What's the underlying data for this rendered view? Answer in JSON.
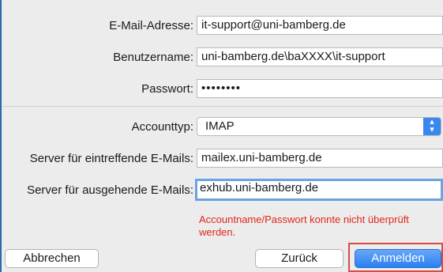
{
  "form": {
    "email_label": "E-Mail-Adresse:",
    "email_value": "it-support@uni-bamberg.de",
    "username_label": "Benutzername:",
    "username_value": "uni-bamberg.de\\baXXXX\\it-support",
    "password_label": "Passwort:",
    "password_value": "••••••••",
    "account_type_label": "Accounttyp:",
    "account_type_value": "IMAP",
    "incoming_label": "Server für eintreffende E-Mails:",
    "incoming_value": "mailex.uni-bamberg.de",
    "outgoing_label": "Server für ausgehende E-Mails:",
    "outgoing_value": "exhub.uni-bamberg.de",
    "error_message": "Accountname/Passwort konnte nicht überprüft werden."
  },
  "buttons": {
    "cancel": "Abbrechen",
    "back": "Zurück",
    "login": "Anmelden"
  },
  "colors": {
    "error": "#e0261a",
    "accent": "#3b87f0",
    "highlight": "#d64d43"
  },
  "icons": {
    "account_type_select": "chevron-up-down-icon"
  }
}
